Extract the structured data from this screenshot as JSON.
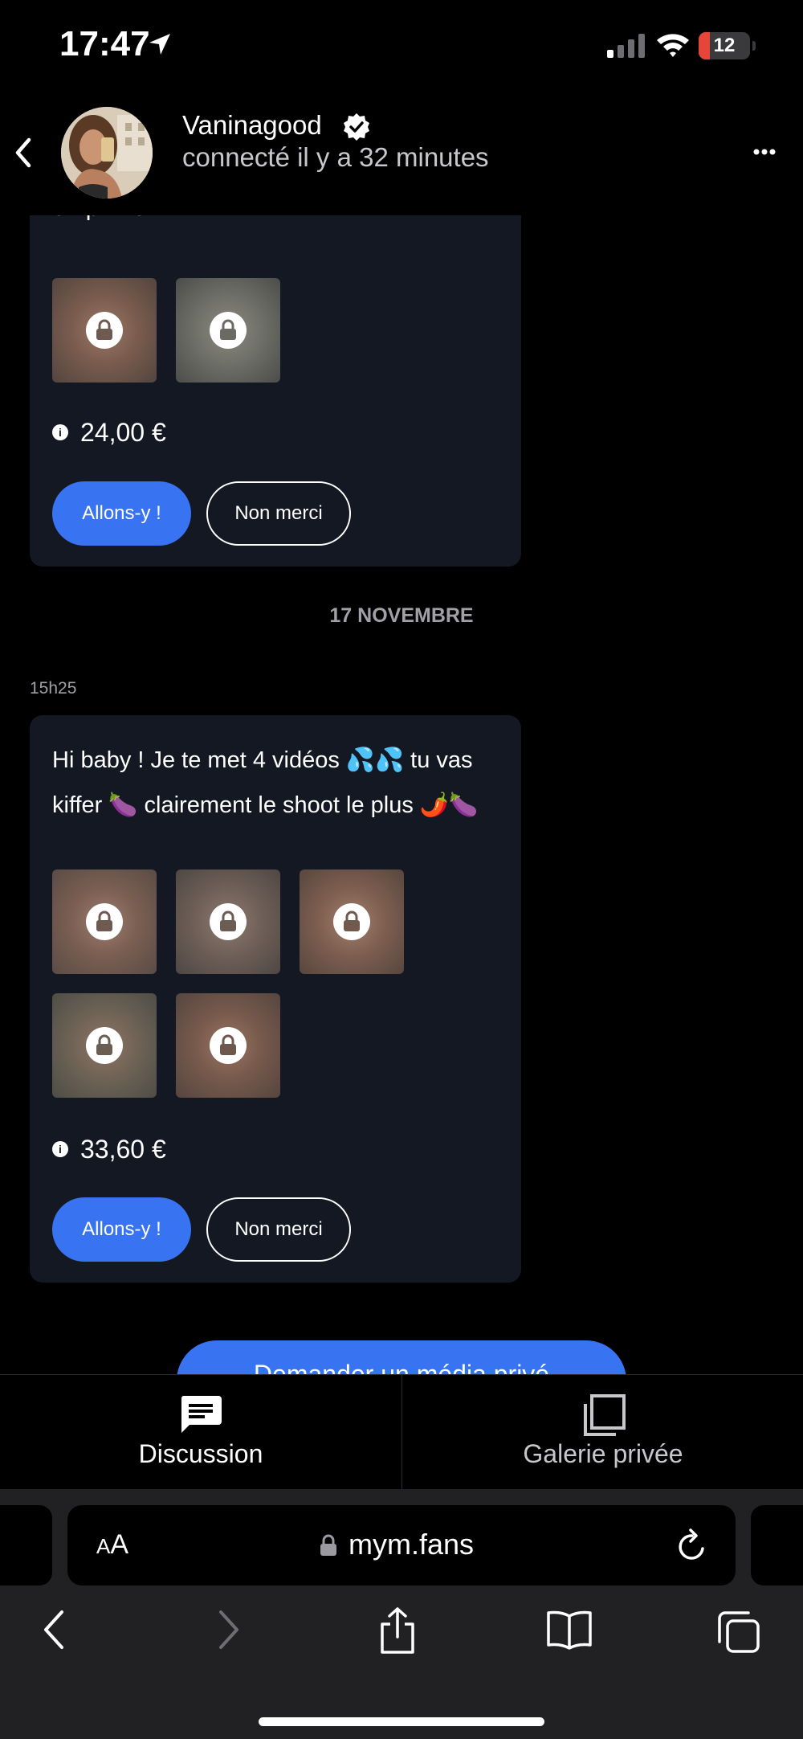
{
  "status_bar": {
    "time": "17:47",
    "battery": "12"
  },
  "header": {
    "username": "Vaninagood",
    "presence": "connecté il y a 32 minutes"
  },
  "messages": [
    {
      "text_cut": "en prime",
      "media_count": 2,
      "price": "24,00 €",
      "accept_label": "Allons-y !",
      "decline_label": "Non merci"
    },
    {
      "text": "Hi baby ! Je te met 4 vidéos 💦💦 tu vas kiffer 🍆 clairement le shoot le plus 🌶️🍆",
      "media_count": 5,
      "price": "33,60 €",
      "accept_label": "Allons-y !",
      "decline_label": "Non merci"
    }
  ],
  "date_separator": "17 NOVEMBRE",
  "timestamp": "15h25",
  "request_button": "Demander un média privé",
  "tabs": [
    {
      "label": "Discussion",
      "icon": "chat-icon",
      "active": true
    },
    {
      "label": "Galerie privée",
      "icon": "gallery-icon",
      "active": false
    }
  ],
  "browser": {
    "text_size_label_small": "A",
    "text_size_label_large": "A",
    "url": "mym.fans"
  },
  "colors": {
    "accent": "#3874f2",
    "bubble": "#141822",
    "background": "#000000"
  }
}
